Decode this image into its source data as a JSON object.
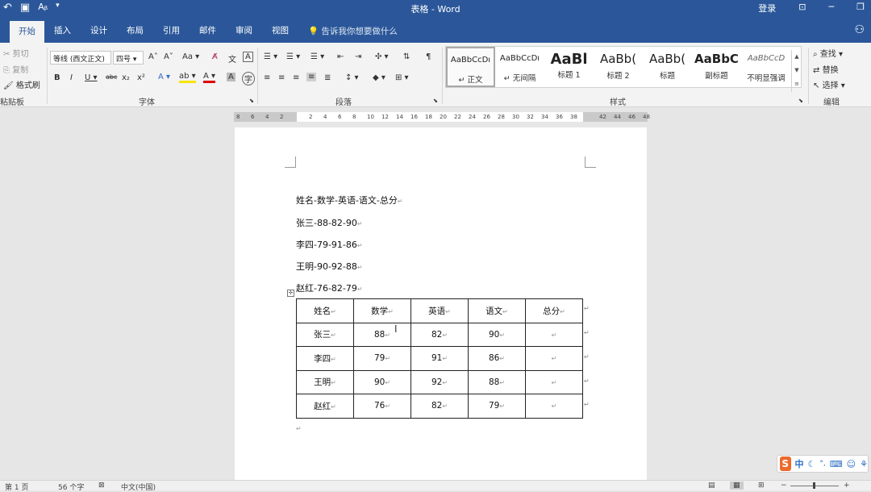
{
  "window": {
    "title": "表格 - Word",
    "signin": "登录",
    "quick_access": [
      "↶",
      "📁",
      "Aᵦ",
      "▾"
    ]
  },
  "tabs": [
    "开始",
    "插入",
    "设计",
    "布局",
    "引用",
    "邮件",
    "审阅",
    "视图"
  ],
  "tell_me": "告诉我你想要做什么",
  "clipboard": {
    "cut": "剪切",
    "copy": "复制",
    "format_painter": "格式刷",
    "label": "粘贴板"
  },
  "font": {
    "name": "等线 (西文正文)",
    "size": "四号",
    "label": "字体"
  },
  "paragraph": {
    "label": "段落"
  },
  "styles": {
    "label": "样式",
    "items": [
      {
        "sample": "AaBbCcDı",
        "name": "↵ 正文"
      },
      {
        "sample": "AaBbCcDı",
        "name": "↵ 无间隔"
      },
      {
        "sample": "AaBl",
        "name": "标题 1"
      },
      {
        "sample": "AaBb(",
        "name": "标题 2"
      },
      {
        "sample": "AaBb(",
        "name": "标题"
      },
      {
        "sample": "AaBbC",
        "name": "副标题"
      },
      {
        "sample": "AaBbCcD",
        "name": "不明显强调"
      }
    ]
  },
  "editing": {
    "find": "查找",
    "replace": "替换",
    "select": "选择",
    "label": "编辑"
  },
  "ruler": [
    "8",
    "6",
    "4",
    "2",
    "",
    "2",
    "4",
    "6",
    "8",
    "10",
    "12",
    "14",
    "16",
    "18",
    "20",
    "22",
    "24",
    "26",
    "28",
    "30",
    "32",
    "34",
    "36",
    "38",
    "",
    "42",
    "44",
    "46",
    "48"
  ],
  "document": {
    "lines": [
      "姓名-数学-英语-语文-总分",
      "张三-88-82-90",
      "李四-79-91-86",
      "王明-90-92-88",
      "赵红-76-82-79"
    ],
    "table": {
      "header": [
        "姓名",
        "数学",
        "英语",
        "语文",
        "总分"
      ],
      "rows": [
        [
          "张三",
          "88",
          "82",
          "90",
          ""
        ],
        [
          "李四",
          "79",
          "91",
          "86",
          ""
        ],
        [
          "王明",
          "90",
          "92",
          "88",
          ""
        ],
        [
          "赵红",
          "76",
          "82",
          "79",
          ""
        ]
      ]
    }
  },
  "status": {
    "page": "第 1 页",
    "words": "56 个字",
    "language": "中文(中国)"
  },
  "ime": {
    "logo": "S",
    "mode": "中"
  },
  "colors": {
    "accent": "#2b579a"
  }
}
